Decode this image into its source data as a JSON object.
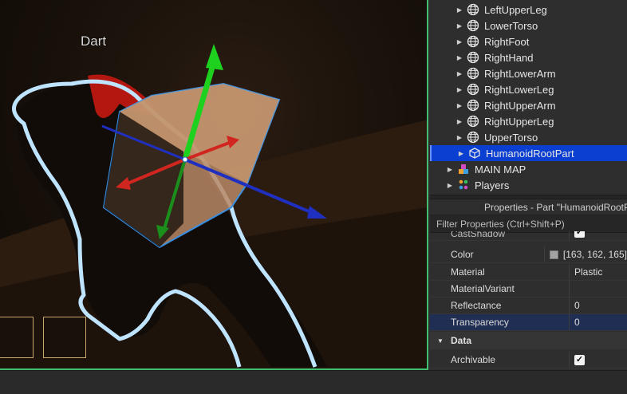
{
  "viewport": {
    "nameplate": "Dart"
  },
  "explorer": {
    "items": [
      {
        "label": "LeftUpperLeg",
        "icon": "mesh-part-icon"
      },
      {
        "label": "LowerTorso",
        "icon": "mesh-part-icon"
      },
      {
        "label": "RightFoot",
        "icon": "mesh-part-icon"
      },
      {
        "label": "RightHand",
        "icon": "mesh-part-icon"
      },
      {
        "label": "RightLowerArm",
        "icon": "mesh-part-icon"
      },
      {
        "label": "RightLowerLeg",
        "icon": "mesh-part-icon"
      },
      {
        "label": "RightUpperArm",
        "icon": "mesh-part-icon"
      },
      {
        "label": "RightUpperLeg",
        "icon": "mesh-part-icon"
      },
      {
        "label": "UpperTorso",
        "icon": "mesh-part-icon"
      },
      {
        "label": "HumanoidRootPart",
        "icon": "part-icon",
        "selected": true
      },
      {
        "label": "MAIN MAP",
        "icon": "model-icon"
      },
      {
        "label": "Players",
        "icon": "players-icon"
      }
    ]
  },
  "properties": {
    "title": "Properties - Part \"HumanoidRootPart\"",
    "filter_placeholder": "Filter Properties (Ctrl+Shift+P)",
    "rows": {
      "cast_shadow": {
        "name": "CastShadow",
        "checked": true
      },
      "color": {
        "name": "Color",
        "value": "[163, 162, 165]",
        "swatch": "#a3a2a5"
      },
      "material": {
        "name": "Material",
        "value": "Plastic"
      },
      "material_variant": {
        "name": "MaterialVariant",
        "value": ""
      },
      "reflectance": {
        "name": "Reflectance",
        "value": "0"
      },
      "transparency": {
        "name": "Transparency",
        "value": "0"
      }
    },
    "data_section": {
      "label": "Data",
      "archivable": {
        "name": "Archivable",
        "checked": true
      }
    }
  },
  "colors": {
    "selection_blue": "#0a3fd1",
    "viewport_border": "#3fbf6f",
    "gizmo_green": "#1fd11f",
    "gizmo_red": "#d1261f",
    "gizmo_blue": "#1f2fbf",
    "outline": "#bfe4ff"
  }
}
